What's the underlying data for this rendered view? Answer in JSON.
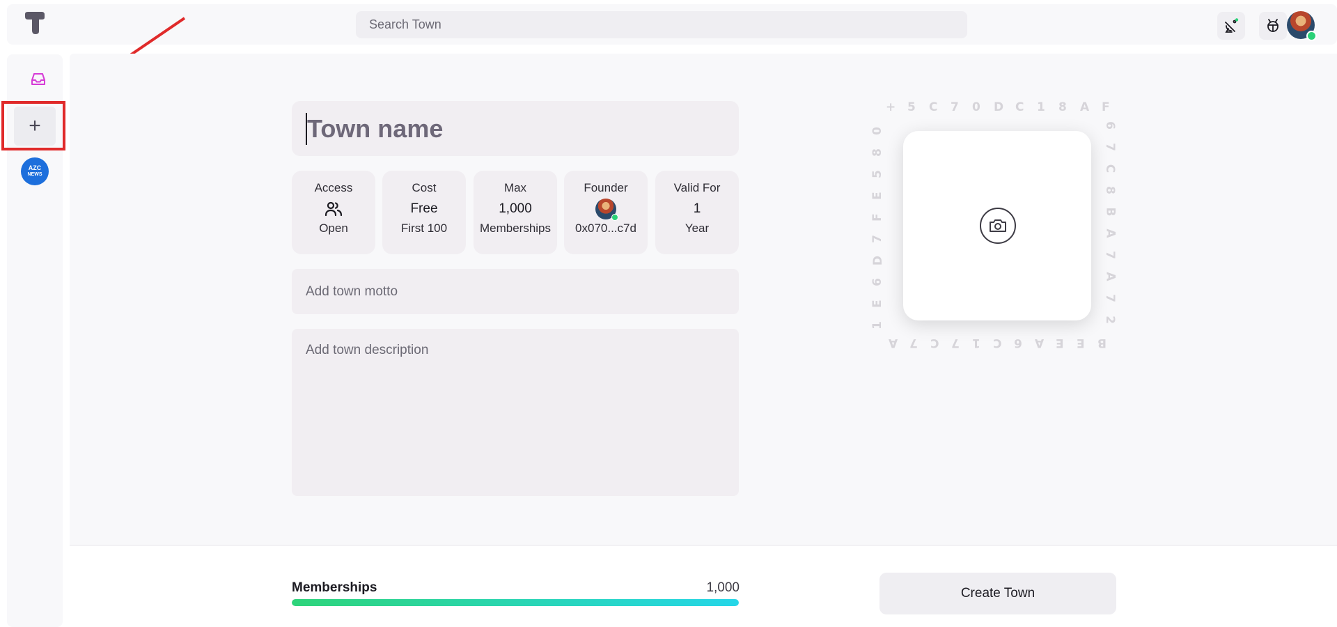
{
  "header": {
    "search_placeholder": "Search Town",
    "icons": [
      "town-logo-icon",
      "satellite-dish-icon",
      "bug-icon",
      "user-avatar"
    ]
  },
  "sidebar": {
    "items": [
      {
        "name": "inbox-icon"
      },
      {
        "name": "plus-icon",
        "label": "+"
      },
      {
        "name": "azc-news-town",
        "label_top": "AZC",
        "label_bottom": "NEWS"
      }
    ]
  },
  "form": {
    "town_name_placeholder": "Town name",
    "stats": [
      {
        "label": "Access",
        "value_icon": "people-icon",
        "sub": "Open"
      },
      {
        "label": "Cost",
        "value": "Free",
        "sub": "First 100"
      },
      {
        "label": "Max",
        "value": "1,000",
        "sub": "Memberships"
      },
      {
        "label": "Founder",
        "value_icon": "founder-avatar",
        "sub": "0x070...c7d"
      },
      {
        "label": "Valid For",
        "value": "1",
        "sub": "Year"
      }
    ],
    "motto_placeholder": "Add town motto",
    "description_placeholder": "Add town description"
  },
  "image_picker": {
    "icon": "camera-icon",
    "hex_top": "+5C70DC18AF",
    "hex_right": "67C8BA7A72",
    "hex_bottom": "A7C71C6AEEB",
    "hex_left": "0 8 5 E F 7 D 6 E 1"
  },
  "footer": {
    "memberships_label": "Memberships",
    "memberships_value": "1,000",
    "memberships_fill": 1.0,
    "create_button": "Create Town"
  },
  "colors": {
    "accent_pink": "#d63bd6",
    "highlight_red": "#e02a2a",
    "progress_start": "#2ed47a",
    "progress_end": "#25d6e8",
    "online": "#2ad177"
  }
}
